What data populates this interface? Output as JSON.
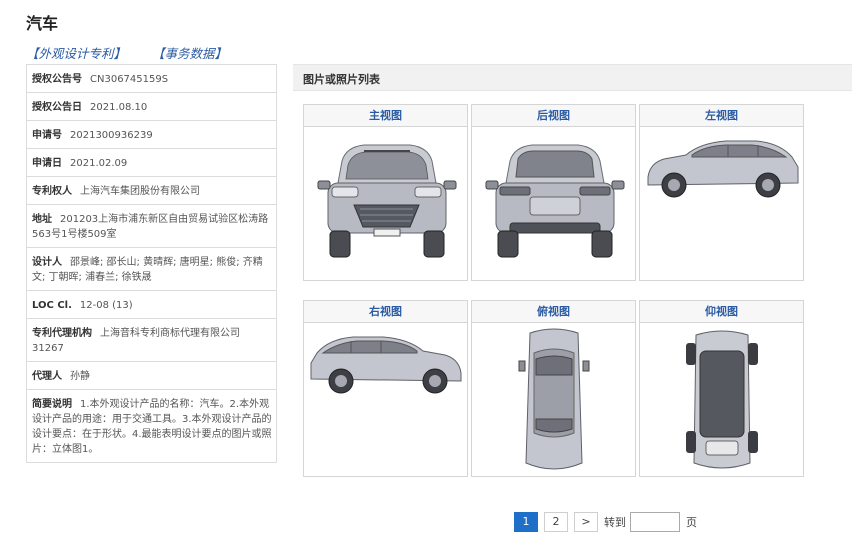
{
  "header": {
    "title": "汽车",
    "links": [
      "【外观设计专利】",
      "【事务数据】"
    ]
  },
  "info": [
    {
      "label": "授权公告号",
      "value": "CN306745159S"
    },
    {
      "label": "授权公告日",
      "value": "2021.08.10"
    },
    {
      "label": "申请号",
      "value": "2021300936239"
    },
    {
      "label": "申请日",
      "value": "2021.02.09"
    },
    {
      "label": "专利权人",
      "value": "上海汽车集团股份有限公司"
    },
    {
      "label": "地址",
      "value": "201203上海市浦东新区自由贸易试验区松涛路563号1号楼509室"
    },
    {
      "label": "设计人",
      "value": "邵景峰; 邵长山; 黄晴辉; 唐明星; 熊俊; 齐精文; 丁朝晖; 浦春兰; 徐铁晟"
    },
    {
      "label": "LOC Cl.",
      "value": "12-08 (13)"
    },
    {
      "label": "专利代理机构",
      "value": "上海音科专利商标代理有限公司 31267"
    },
    {
      "label": "代理人",
      "value": "孙静"
    },
    {
      "label": "简要说明",
      "value": "1.本外观设计产品的名称：汽车。2.本外观设计产品的用途：用于交通工具。3.本外观设计产品的设计要点：在于形状。4.最能表明设计要点的图片或照片：立体图1。"
    }
  ],
  "photos": {
    "heading": "图片或照片列表",
    "views": [
      {
        "label": "主视图",
        "icon": "car-front-view-icon"
      },
      {
        "label": "后视图",
        "icon": "car-rear-view-icon"
      },
      {
        "label": "左视图",
        "icon": "car-left-view-icon"
      },
      {
        "label": "右视图",
        "icon": "car-right-view-icon"
      },
      {
        "label": "俯视图",
        "icon": "car-top-view-icon"
      },
      {
        "label": "仰视图",
        "icon": "car-bottom-view-icon"
      }
    ]
  },
  "pager": {
    "pages": [
      "1",
      "2"
    ],
    "current": "1",
    "next": ">",
    "goto_label": "转到",
    "page_suffix": "页",
    "input_value": ""
  },
  "colors": {
    "link": "#2a5ba3",
    "active_page": "#1f6ec7"
  }
}
